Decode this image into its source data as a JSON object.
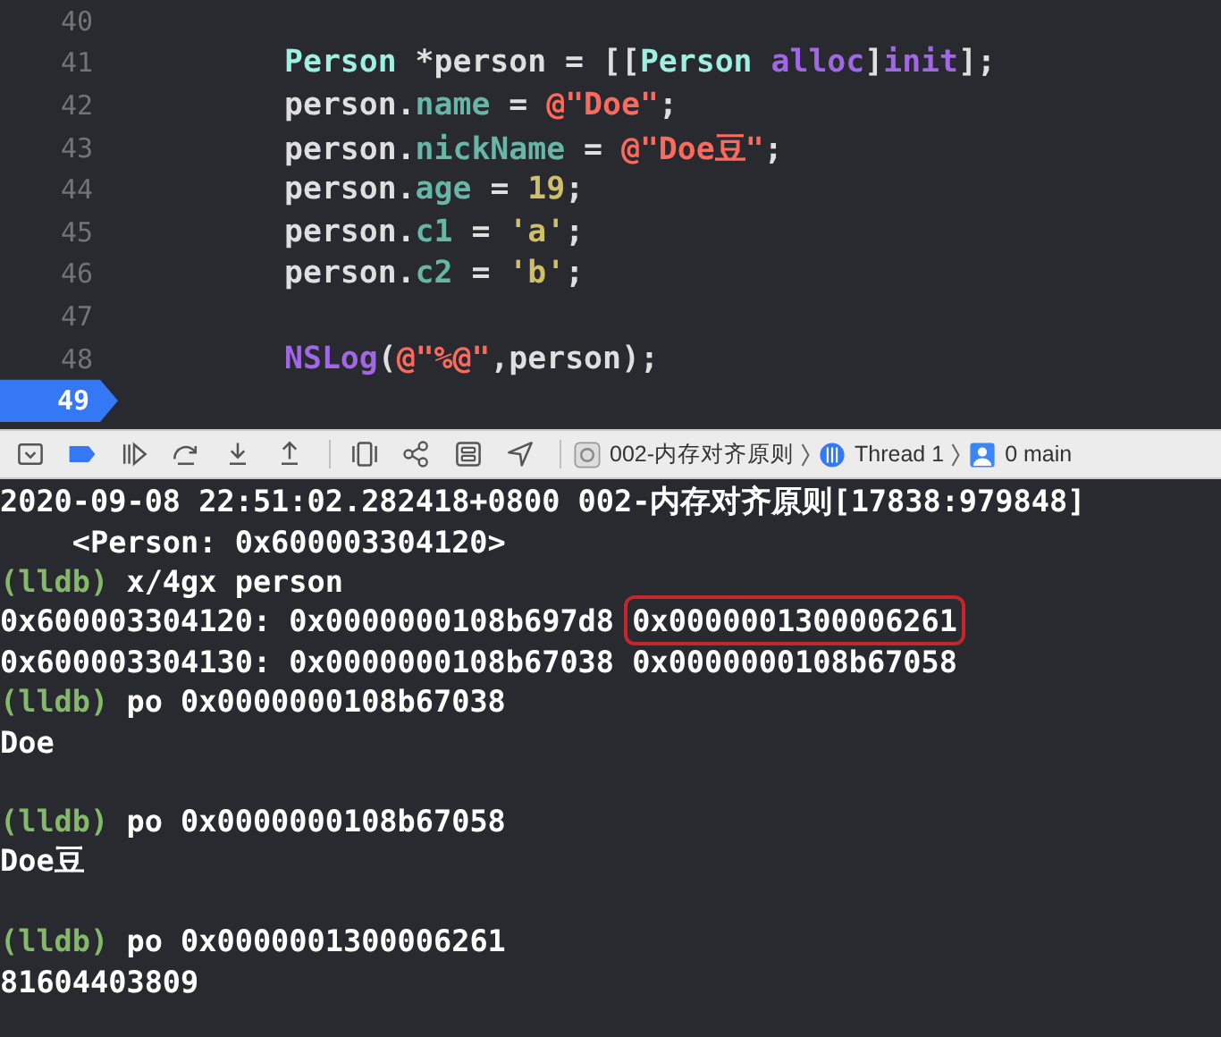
{
  "editor": {
    "lines": [
      {
        "number": "40",
        "current": false
      },
      {
        "number": "41",
        "current": false,
        "tokens": [
          {
            "kind": "type",
            "text": "Person"
          },
          {
            "kind": "plain",
            "text": " *person = [["
          },
          {
            "kind": "type",
            "text": "Person"
          },
          {
            "kind": "method",
            "text": " alloc"
          },
          {
            "kind": "plain",
            "text": "]"
          },
          {
            "kind": "method",
            "text": "init"
          },
          {
            "kind": "plain",
            "text": "];"
          }
        ]
      },
      {
        "number": "42",
        "current": false,
        "tokens": [
          {
            "kind": "plain",
            "text": "person."
          },
          {
            "kind": "property",
            "text": "name"
          },
          {
            "kind": "plain",
            "text": " = "
          },
          {
            "kind": "string",
            "text": "@\"Doe\""
          },
          {
            "kind": "plain",
            "text": ";"
          }
        ]
      },
      {
        "number": "43",
        "current": false,
        "tokens": [
          {
            "kind": "plain",
            "text": "person."
          },
          {
            "kind": "property",
            "text": "nickName"
          },
          {
            "kind": "plain",
            "text": " = "
          },
          {
            "kind": "string",
            "text": "@\"Doe豆\""
          },
          {
            "kind": "plain",
            "text": ";"
          }
        ]
      },
      {
        "number": "44",
        "current": false,
        "tokens": [
          {
            "kind": "plain",
            "text": "person."
          },
          {
            "kind": "property",
            "text": "age"
          },
          {
            "kind": "plain",
            "text": " = "
          },
          {
            "kind": "number",
            "text": "19"
          },
          {
            "kind": "plain",
            "text": ";"
          }
        ]
      },
      {
        "number": "45",
        "current": false,
        "tokens": [
          {
            "kind": "plain",
            "text": "person."
          },
          {
            "kind": "property",
            "text": "c1"
          },
          {
            "kind": "plain",
            "text": " = "
          },
          {
            "kind": "number",
            "text": "'a'"
          },
          {
            "kind": "plain",
            "text": ";"
          }
        ]
      },
      {
        "number": "46",
        "current": false,
        "tokens": [
          {
            "kind": "plain",
            "text": "person."
          },
          {
            "kind": "property",
            "text": "c2"
          },
          {
            "kind": "plain",
            "text": " = "
          },
          {
            "kind": "number",
            "text": "'b'"
          },
          {
            "kind": "plain",
            "text": ";"
          }
        ]
      },
      {
        "number": "47",
        "current": false
      },
      {
        "number": "48",
        "current": false,
        "tokens": [
          {
            "kind": "method",
            "text": "NSLog"
          },
          {
            "kind": "plain",
            "text": "("
          },
          {
            "kind": "string",
            "text": "@\"%@\""
          },
          {
            "kind": "plain",
            "text": ",person);"
          }
        ]
      },
      {
        "number": "49",
        "current": true
      }
    ]
  },
  "debug_bar": {
    "breakpoints_active": true,
    "breadcrumbs": [
      {
        "kind": "app",
        "text": "002-内存对齐原则"
      },
      {
        "kind": "thread",
        "text": "Thread 1"
      },
      {
        "kind": "frame",
        "text": "0 main"
      }
    ]
  },
  "console": {
    "lines": [
      {
        "segments": [
          {
            "kind": "output",
            "text": "2020-09-08 22:51:02.282418+0800 002-内存对齐原则[17838:979848]"
          }
        ]
      },
      {
        "segments": [
          {
            "kind": "output",
            "text": "    <Person: 0x600003304120>"
          }
        ]
      },
      {
        "segments": [
          {
            "kind": "prompt",
            "text": "(lldb)"
          },
          {
            "kind": "output",
            "text": " x/4gx person"
          }
        ]
      },
      {
        "segments": [
          {
            "kind": "output",
            "text": "0x600003304120: 0x0000000108b697d8 "
          },
          {
            "kind": "highlight",
            "text": "0x0000001300006261"
          }
        ]
      },
      {
        "segments": [
          {
            "kind": "output",
            "text": "0x600003304130: 0x0000000108b67038 0x0000000108b67058"
          }
        ]
      },
      {
        "segments": [
          {
            "kind": "prompt",
            "text": "(lldb)"
          },
          {
            "kind": "output",
            "text": " po 0x0000000108b67038"
          }
        ]
      },
      {
        "segments": [
          {
            "kind": "output",
            "text": "Doe"
          }
        ]
      },
      {
        "gap_before": true,
        "segments": [
          {
            "kind": "prompt",
            "text": "(lldb)"
          },
          {
            "kind": "output",
            "text": " po 0x0000000108b67058"
          }
        ]
      },
      {
        "segments": [
          {
            "kind": "output",
            "text": "Doe豆"
          }
        ]
      },
      {
        "gap_before": true,
        "segments": [
          {
            "kind": "prompt",
            "text": "(lldb)"
          },
          {
            "kind": "output",
            "text": " po 0x0000001300006261"
          }
        ]
      },
      {
        "segments": [
          {
            "kind": "output",
            "text": "81604403809"
          }
        ]
      }
    ]
  }
}
